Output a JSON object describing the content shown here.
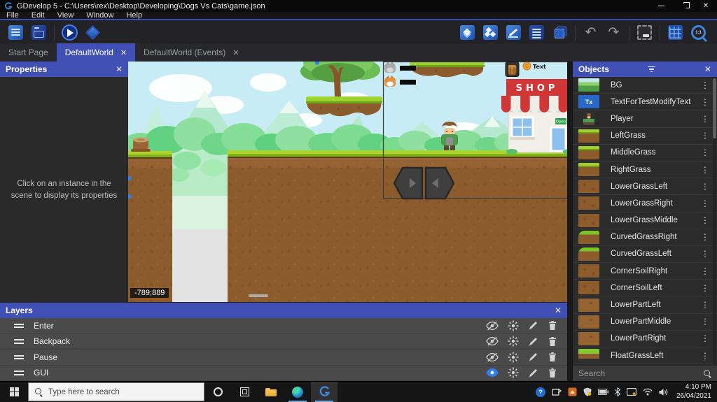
{
  "window": {
    "title": "GDevelop 5 - C:\\Users\\rex\\Desktop\\Developing\\Dogs Vs Cats\\game.json"
  },
  "glyphs": {
    "close": "✕",
    "menu_dots": "⋮",
    "tx": "Tx",
    "undo": "↶",
    "redo": "↷",
    "question": "?",
    "zoom_ratio": "1:1"
  },
  "menu": {
    "items": [
      "File",
      "Edit",
      "View",
      "Window",
      "Help"
    ]
  },
  "tabs": [
    {
      "label": "Start Page"
    },
    {
      "label": "DefaultWorld"
    },
    {
      "label": "DefaultWorld (Events)"
    }
  ],
  "properties_panel": {
    "title": "Properties",
    "empty_message": "Click on an instance in the scene to display its properties"
  },
  "scene": {
    "coordinates": "-789;889",
    "shop_sign": "SHOP",
    "open_sign": "Open",
    "coin_label": "Text"
  },
  "objects_panel": {
    "title": "Objects",
    "search_placeholder": "Search",
    "items": [
      {
        "name": "BG"
      },
      {
        "name": "TextForTestModifyText"
      },
      {
        "name": "Player"
      },
      {
        "name": "LeftGrass"
      },
      {
        "name": "MiddleGrass"
      },
      {
        "name": "RightGrass"
      },
      {
        "name": "LowerGrassLeft"
      },
      {
        "name": "LowerGrassRight"
      },
      {
        "name": "LowerGrassMiddle"
      },
      {
        "name": "CurvedGrassRight"
      },
      {
        "name": "CurvedGrassLeft"
      },
      {
        "name": "CornerSoilRight"
      },
      {
        "name": "CornerSoilLeft"
      },
      {
        "name": "LowerPartLeft"
      },
      {
        "name": "LowerPartMiddle"
      },
      {
        "name": "LowerPartRight"
      },
      {
        "name": "FloatGrassLeft"
      }
    ]
  },
  "layers_panel": {
    "title": "Layers",
    "rows": [
      {
        "name": "Enter",
        "visible": false
      },
      {
        "name": "Backpack",
        "visible": false
      },
      {
        "name": "Pause",
        "visible": false
      },
      {
        "name": "GUI",
        "visible": true
      }
    ]
  },
  "taskbar": {
    "search_placeholder": "Type here to search",
    "time": "4:10 PM",
    "date": "26/04/2021"
  },
  "colors": {
    "accent": "#4150b5",
    "visible_eye": "#2e7ef2",
    "selection_handle": "#2e7ef2"
  }
}
